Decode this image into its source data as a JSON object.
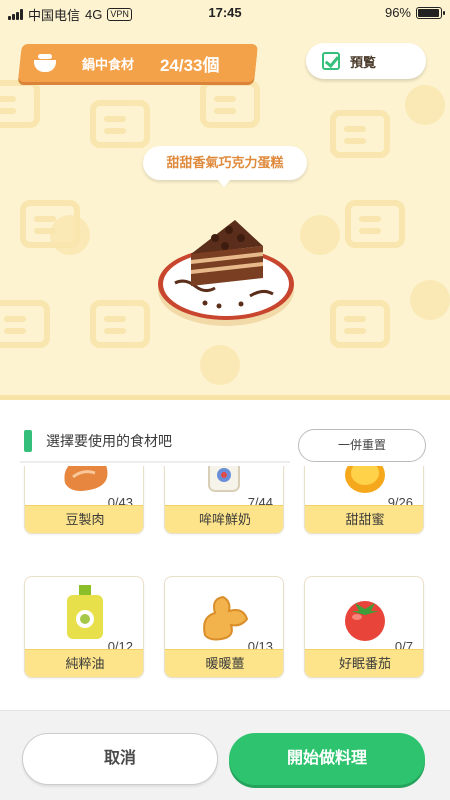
{
  "status_bar": {
    "carrier": "中国电信",
    "network": "4G",
    "vpn": "VPN",
    "time": "17:45",
    "battery": "96%",
    "battery_level": 0.96
  },
  "header": {
    "pot_label": "鍋中食材",
    "pot_count": "24/33個",
    "preview_label": "預覧"
  },
  "dish": {
    "name": "甜甜香氣巧克力蛋糕"
  },
  "panel": {
    "prompt": "選擇要使用的食材吧",
    "reset_label": "一併重置"
  },
  "ingredients": [
    {
      "name": "豆製肉",
      "count": "0/43",
      "icon": "soy-meat-icon"
    },
    {
      "name": "哞哞鮮奶",
      "count": "7/44",
      "icon": "milk-bottle-icon"
    },
    {
      "name": "甜甜蜜",
      "count": "9/26",
      "icon": "honey-jar-icon"
    },
    {
      "name": "純粹油",
      "count": "0/12",
      "icon": "oil-bottle-icon"
    },
    {
      "name": "暖暖薑",
      "count": "0/13",
      "icon": "ginger-icon"
    },
    {
      "name": "好眠番茄",
      "count": "0/7",
      "icon": "tomato-icon"
    }
  ],
  "footer": {
    "cancel_label": "取消",
    "cook_label": "開始做料理"
  },
  "colors": {
    "accent_green": "#2ec46f",
    "banner_orange": "#f4a24a",
    "label_yellow": "#fde48a",
    "scene_bg": "#fdf3d0"
  }
}
